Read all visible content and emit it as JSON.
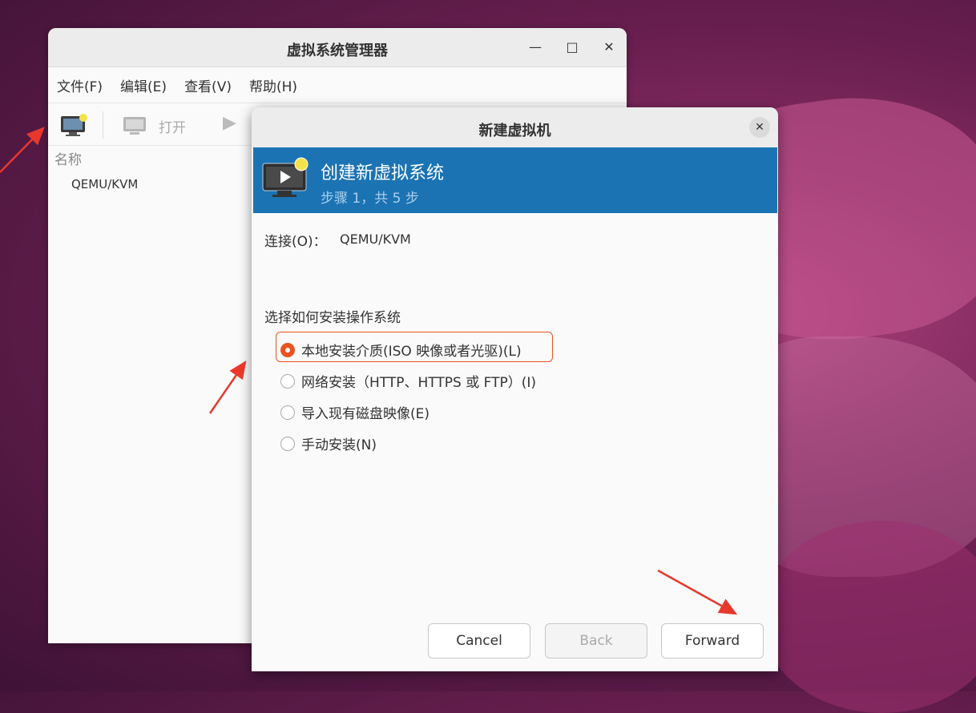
{
  "main_window": {
    "title": "虚拟系统管理器",
    "menu": [
      "文件(F)",
      "编辑(E)",
      "查看(V)",
      "帮助(H)"
    ],
    "toolbar_open_label": "打开",
    "list_header": "名称",
    "connection_item": "QEMU/KVM"
  },
  "dialog": {
    "title": "新建虚拟机",
    "banner_title": "创建新虚拟系统",
    "banner_subtitle": "步骤 1，共 5 步",
    "connection_label": "连接(O)：",
    "connection_value": "QEMU/KVM",
    "install_heading": "选择如何安装操作系统",
    "options": [
      "本地安装介质(ISO 映像或者光驱)(L)",
      "网络安装（HTTP、HTTPS 或 FTP）(I)",
      "导入现有磁盘映像(E)",
      "手动安装(N)"
    ],
    "selected_option": 0,
    "buttons": {
      "cancel": "Cancel",
      "back": "Back",
      "forward": "Forward"
    }
  },
  "colors": {
    "accent": "#e95420",
    "banner": "#1b73b3",
    "annotation": "#e8382c"
  }
}
